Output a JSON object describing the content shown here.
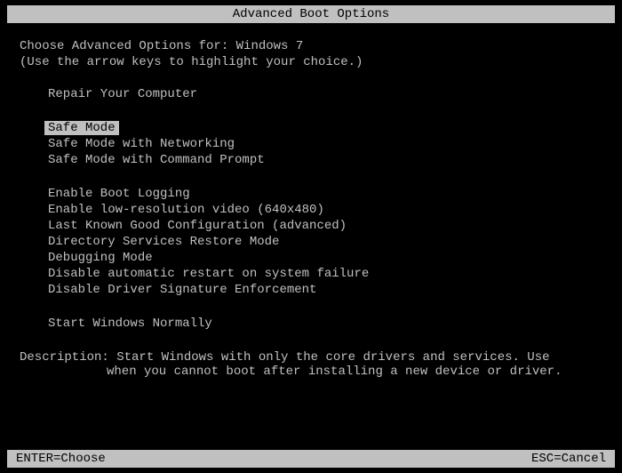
{
  "title": "Advanced Boot Options",
  "choose_prefix": "Choose Advanced Options for: ",
  "os_name": "Windows 7",
  "hint": "(Use the arrow keys to highlight your choice.)",
  "groups": [
    {
      "items": [
        {
          "id": "repair-computer",
          "label": "Repair Your Computer",
          "selected": false
        }
      ]
    },
    {
      "items": [
        {
          "id": "safe-mode",
          "label": "Safe Mode",
          "selected": true
        },
        {
          "id": "safe-mode-networking",
          "label": "Safe Mode with Networking",
          "selected": false
        },
        {
          "id": "safe-mode-cmd",
          "label": "Safe Mode with Command Prompt",
          "selected": false
        }
      ]
    },
    {
      "items": [
        {
          "id": "enable-boot-logging",
          "label": "Enable Boot Logging",
          "selected": false
        },
        {
          "id": "low-res-video",
          "label": "Enable low-resolution video (640x480)",
          "selected": false
        },
        {
          "id": "last-known-good",
          "label": "Last Known Good Configuration (advanced)",
          "selected": false
        },
        {
          "id": "directory-services-restore",
          "label": "Directory Services Restore Mode",
          "selected": false
        },
        {
          "id": "debugging-mode",
          "label": "Debugging Mode",
          "selected": false
        },
        {
          "id": "disable-auto-restart",
          "label": "Disable automatic restart on system failure",
          "selected": false
        },
        {
          "id": "disable-driver-sig",
          "label": "Disable Driver Signature Enforcement",
          "selected": false
        }
      ]
    },
    {
      "items": [
        {
          "id": "start-normally",
          "label": "Start Windows Normally",
          "selected": false
        }
      ]
    }
  ],
  "description_label": "Description: ",
  "description_line1": "Start Windows with only the core drivers and services. Use",
  "description_line2": "when you cannot boot after installing a new device or driver.",
  "footer": {
    "enter": "ENTER=Choose",
    "esc": "ESC=Cancel"
  }
}
